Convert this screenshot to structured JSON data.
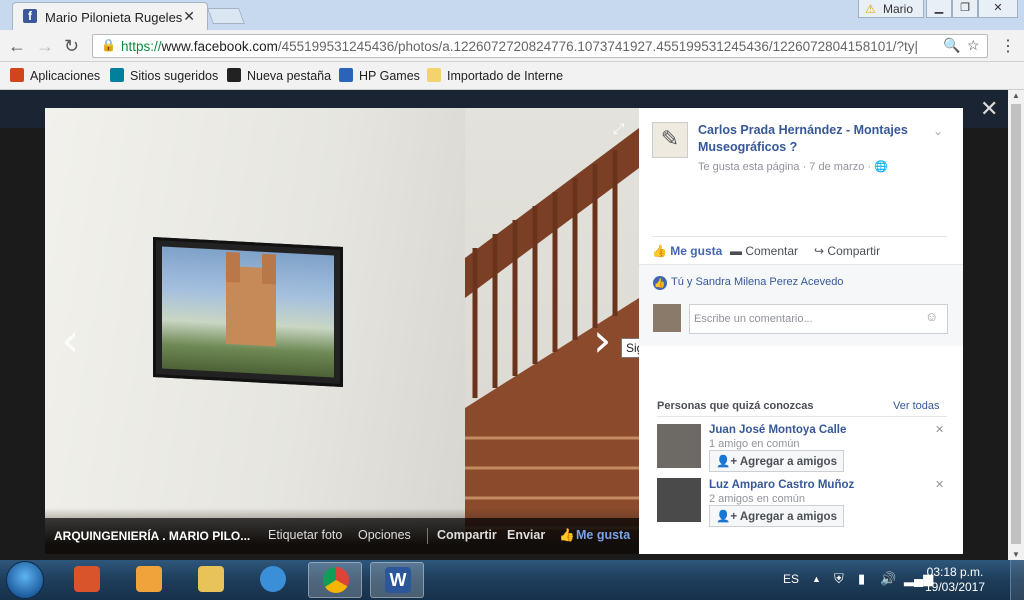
{
  "browser": {
    "tab_title": "Mario Pilonieta Rugeles",
    "user_badge": "Mario",
    "url_scheme": "https://",
    "url_host": "www.facebook.com",
    "url_path": "/455199531245436/photos/a.1226072720824776.1073741927.455199531245436/1226072804158101/?ty|",
    "bookmarks": [
      {
        "label": "Aplicaciones",
        "icon": "apps-icon",
        "color": "#d0451b"
      },
      {
        "label": "Sitios sugeridos",
        "icon": "bing-icon",
        "color": "#00809d"
      },
      {
        "label": "Nueva pestaña",
        "icon": "bookmark-icon",
        "color": "#222222"
      },
      {
        "label": "HP Games",
        "icon": "hp-games-icon",
        "color": "#2a63b8"
      },
      {
        "label": "Importado de Interne",
        "icon": "folder-icon",
        "color": "#f3d36c"
      }
    ]
  },
  "viewer": {
    "next_tooltip": "Siguiente",
    "caption_title": "ARQUINGENIERÍA . MARIO PILO...",
    "actions": {
      "tag": "Etiquetar foto",
      "options": "Opciones",
      "share": "Compartir",
      "send": "Enviar",
      "like": "Me gusta"
    }
  },
  "panel": {
    "page_name": "Carlos Prada Hernández - Montajes Museográficos ?",
    "meta": "Te gusta esta página · 7 de marzo ·",
    "like_label": "Me gusta",
    "comment_label": "Comentar",
    "share_label": "Compartir",
    "likers": "Tú y Sandra Milena Perez Acevedo",
    "comment_placeholder": "Escribe un comentario...",
    "people_title": "Personas que quizá conozcas",
    "see_all": "Ver todas",
    "people": [
      {
        "name": "Juan José Montoya Calle",
        "mutual": "1 amigo en común",
        "button": "Agregar a amigos"
      },
      {
        "name": "Luz Amparo Castro Muñoz",
        "mutual": "2 amigos en común",
        "button": "Agregar a amigos"
      }
    ]
  },
  "taskbar": {
    "lang": "ES",
    "time": "03:18 p.m.",
    "date": "19/03/2017"
  }
}
